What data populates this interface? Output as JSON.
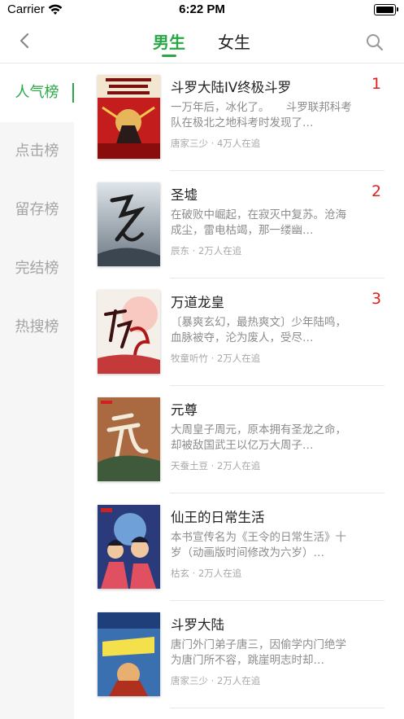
{
  "status_bar": {
    "carrier": "Carrier",
    "time": "6:22 PM"
  },
  "nav": {
    "tabs": [
      {
        "label": "男生"
      },
      {
        "label": "女生"
      }
    ]
  },
  "sidebar": {
    "items": [
      {
        "label": "人气榜"
      },
      {
        "label": "点击榜"
      },
      {
        "label": "留存榜"
      },
      {
        "label": "完结榜"
      },
      {
        "label": "热搜榜"
      }
    ]
  },
  "books": [
    {
      "title": "斗罗大陆IV终极斗罗",
      "rank": "1",
      "desc": "一万年后，冰化了。　　斗罗联邦科考队在极北之地科考时发现了…",
      "meta": "唐家三少 · 4万人在追"
    },
    {
      "title": "圣墟",
      "rank": "2",
      "desc": "在破败中崛起，在寂灭中复苏。沧海成尘，雷电枯竭，那一缕幽…",
      "meta": "辰东 · 2万人在追"
    },
    {
      "title": "万道龙皇",
      "rank": "3",
      "desc": "〔暴爽玄幻，最热爽文〕少年陆鸣，血脉被夺，沦为废人，受尽…",
      "meta": "牧童听竹 · 2万人在追"
    },
    {
      "title": "元尊",
      "rank": "",
      "desc": "大周皇子周元，原本拥有圣龙之命，却被敌国武王以亿万大周子…",
      "meta": "天蚕土豆 · 2万人在追"
    },
    {
      "title": "仙王的日常生活",
      "rank": "",
      "desc": "本书宣传名为《王令的日常生活》十岁（动画版时间修改为六岁）…",
      "meta": "枯玄 · 2万人在追"
    },
    {
      "title": "斗罗大陆",
      "rank": "",
      "desc": "唐门外门弟子唐三，因偷学内门绝学为唐门所不容，跳崖明志时却…",
      "meta": "唐家三少 · 2万人在追"
    }
  ],
  "colors": {
    "accent": "#27a845",
    "rank": "#e02020"
  }
}
